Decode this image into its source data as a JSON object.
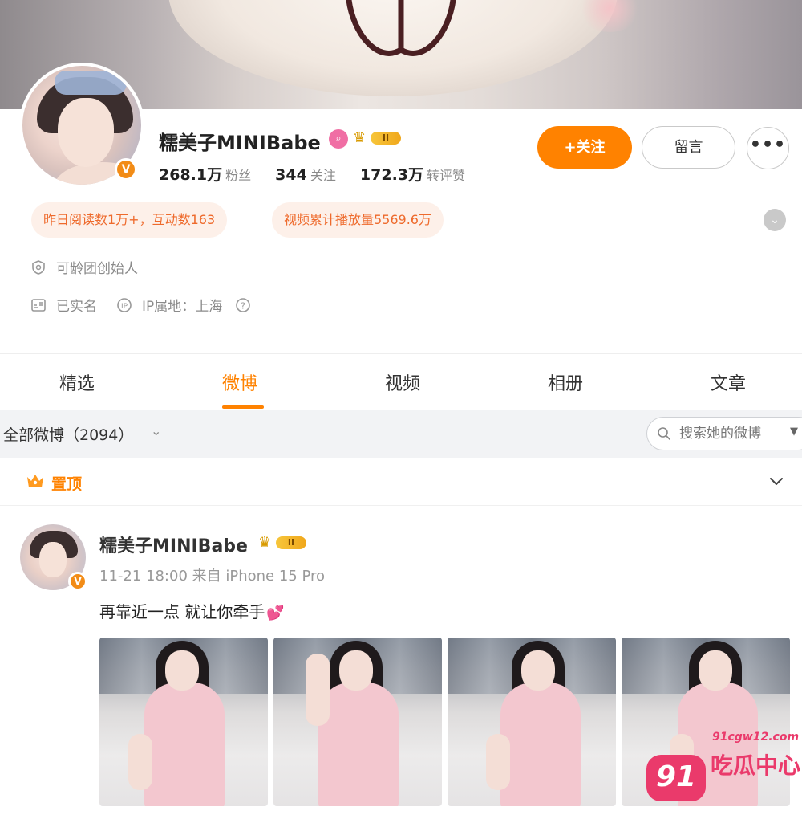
{
  "profile": {
    "name": "糯美子MINIBabe",
    "level_badge": "II",
    "stats": [
      {
        "value": "268.1万",
        "label": "粉丝"
      },
      {
        "value": "344",
        "label": "关注"
      },
      {
        "value": "172.3万",
        "label": "转评赞"
      }
    ],
    "follow_label": "+关注",
    "message_label": "留言",
    "more_label": "•••",
    "tags": [
      "昨日阅读数1万+，互动数163",
      "视频累计播放量5569.6万"
    ],
    "group_info": "可龄团创始人",
    "verified_info": "已实名",
    "ip_info": "IP属地：上海"
  },
  "tabs": [
    "精选",
    "微博",
    "视频",
    "相册",
    "文章"
  ],
  "active_tab": "微博",
  "filter": {
    "label": "全部微博（2094）",
    "search_placeholder": "搜索她的微博"
  },
  "pinned": {
    "label": "置顶"
  },
  "post": {
    "author": "糯美子MINIBabe",
    "level_badge": "II",
    "meta": "11-21 18:00 来自 iPhone 15 Pro",
    "text": "再靠近一点 就让你牵手",
    "emoji": "💕",
    "photo_count": 4
  },
  "watermark": {
    "number": "91",
    "domain": "91cgw12.com",
    "name": "吃瓜中心"
  },
  "colors": {
    "accent": "#ff8200",
    "tag_text": "#ee6a2c",
    "tag_bg": "#fdf0e9",
    "watermark": "#ea3a6b"
  }
}
